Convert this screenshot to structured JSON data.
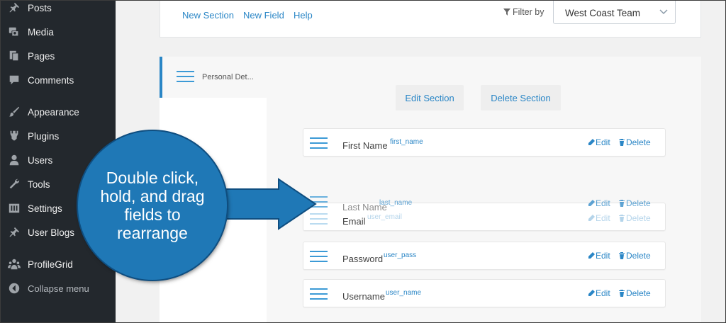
{
  "sidebar": {
    "items": [
      {
        "label": "Posts",
        "icon": "pin-icon"
      },
      {
        "label": "Media",
        "icon": "media-icon"
      },
      {
        "label": "Pages",
        "icon": "pages-icon"
      },
      {
        "label": "Comments",
        "icon": "comments-icon"
      },
      {
        "label": "Appearance",
        "icon": "brush-icon"
      },
      {
        "label": "Plugins",
        "icon": "plugin-icon"
      },
      {
        "label": "Users",
        "icon": "user-icon"
      },
      {
        "label": "Tools",
        "icon": "wrench-icon"
      },
      {
        "label": "Settings",
        "icon": "settings-icon"
      },
      {
        "label": "User Blogs",
        "icon": "pin-icon"
      },
      {
        "label": "ProfileGrid",
        "icon": "group-icon"
      }
    ],
    "collapse_label": "Collapse menu"
  },
  "toolbar": {
    "new_section": "New Section",
    "new_field": "New Field",
    "help": "Help",
    "filter_label": "Filter by",
    "filter_value": "West Coast Team"
  },
  "section": {
    "tab_label": "Personal Det...",
    "edit_button": "Edit Section",
    "delete_button": "Delete Section"
  },
  "fields": [
    {
      "name": "First Name",
      "slug": "first_name"
    },
    {
      "name": "Last Name",
      "slug": "last_name"
    },
    {
      "name": "Email",
      "slug": "user_email"
    },
    {
      "name": "Password",
      "slug": "user_pass"
    },
    {
      "name": "Username",
      "slug": "user_name"
    }
  ],
  "actions": {
    "edit": "Edit",
    "delete": "Delete"
  },
  "callout": {
    "text": "Double click, hold, and drag fields to rearrange"
  },
  "colors": {
    "accent": "#2a86c6",
    "sidebar": "#23282d",
    "callout": "#1f78b6"
  }
}
